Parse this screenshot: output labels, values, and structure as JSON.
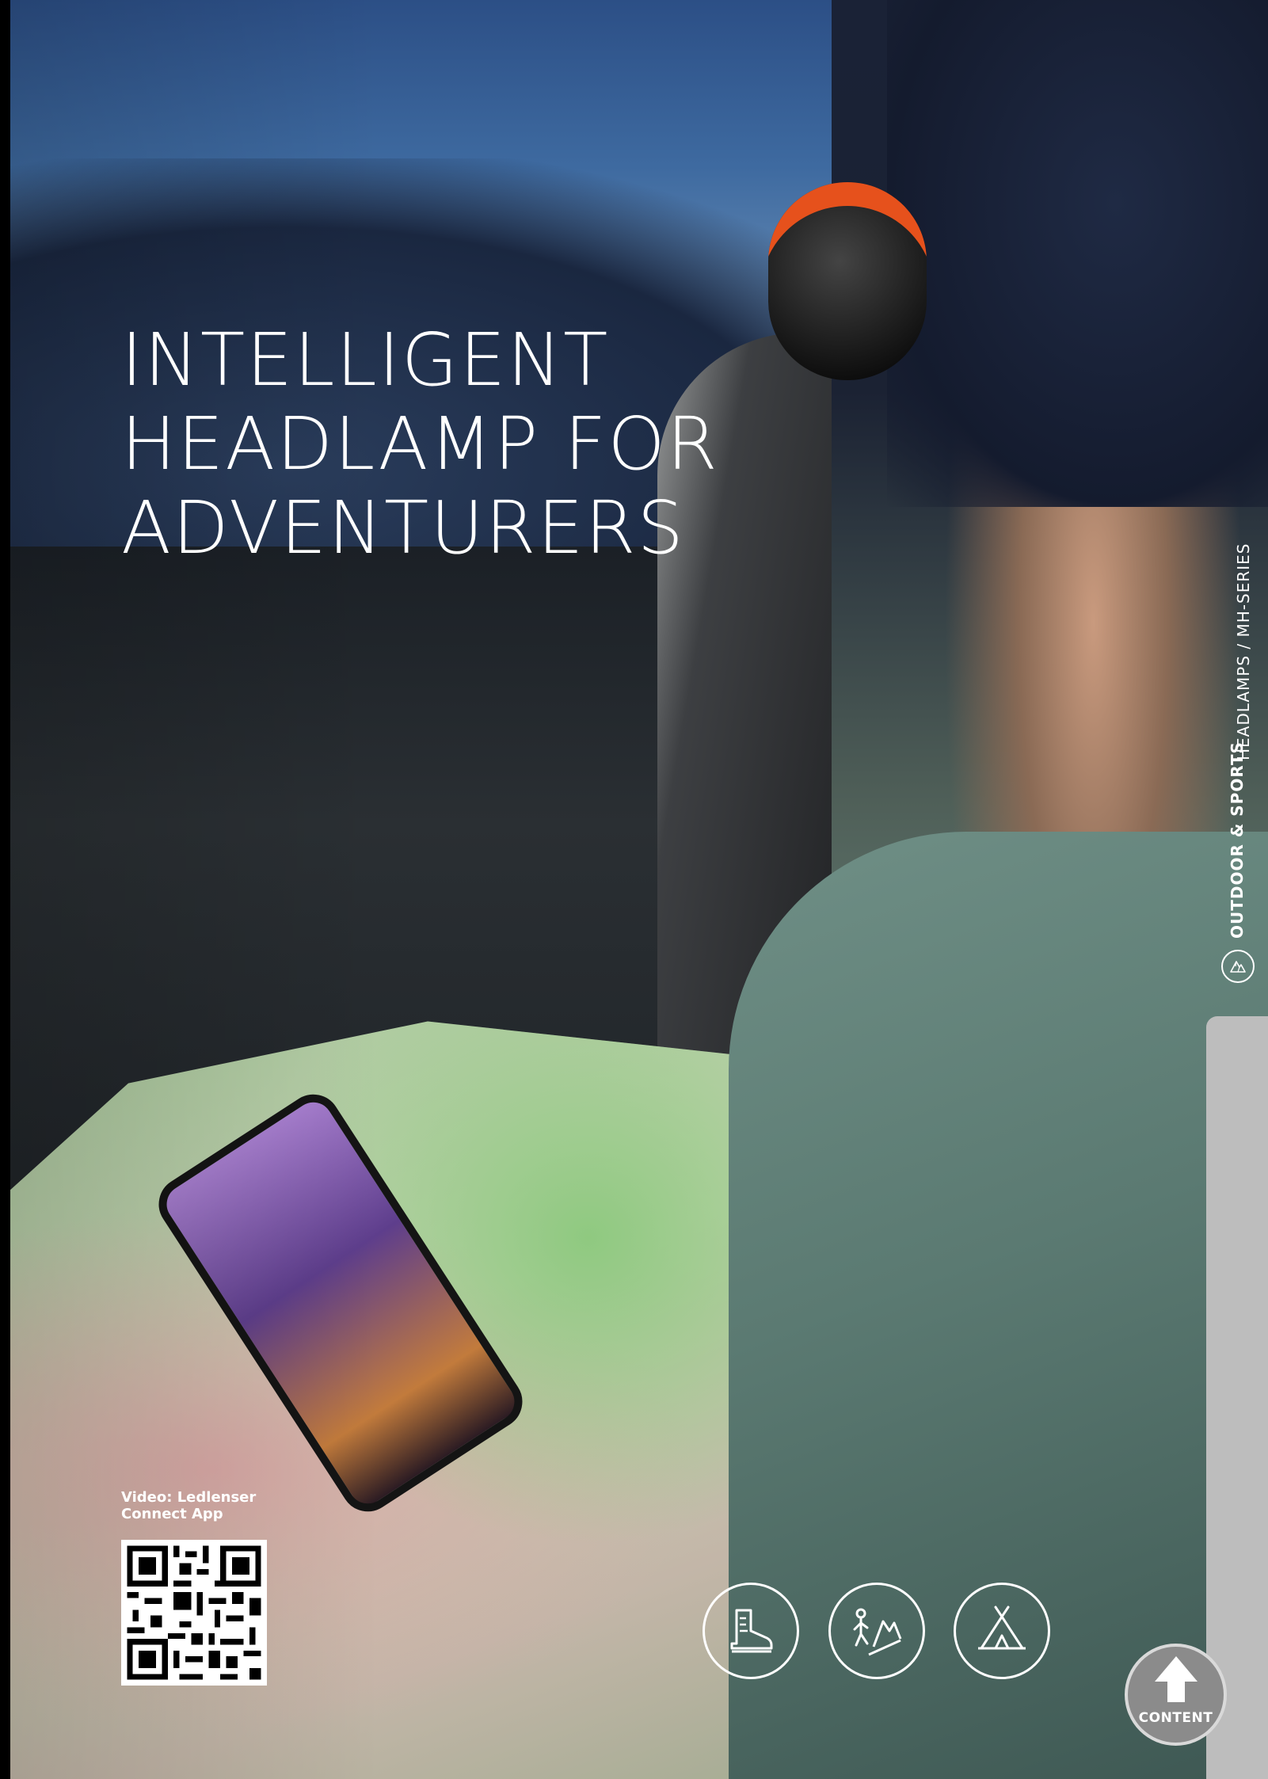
{
  "headline": "INTELLIGENT\nHEADLAMP FOR\nADVENTURERS",
  "side": {
    "series_label": "HEADLAMPS / MH-SERIES",
    "category_label": "OUTDOOR & SPORTS",
    "category_icon": "mountain-circle-icon"
  },
  "video": {
    "caption": "Video: Ledlenser\nConnect App"
  },
  "activities": [
    {
      "icon": "hiking-boot-icon"
    },
    {
      "icon": "climbing-icon"
    },
    {
      "icon": "camping-tent-icon"
    }
  ],
  "content_button": {
    "label": "CONTENT",
    "icon": "arrow-up-icon"
  },
  "colors": {
    "text": "#ffffff",
    "sidebar_grey": "#bdbdbd",
    "button_grey": "#8b8b8b"
  }
}
